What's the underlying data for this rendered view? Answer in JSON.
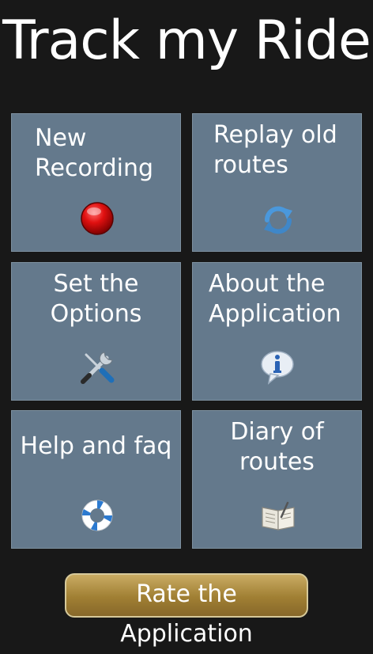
{
  "app": {
    "title": "Track my Ride"
  },
  "tiles": [
    {
      "label": "New\nRecording",
      "icon": "record-icon"
    },
    {
      "label": "Replay old\nroutes",
      "icon": "refresh-icon"
    },
    {
      "label": "Set the\nOptions",
      "icon": "tools-icon"
    },
    {
      "label": "About the\nApplication",
      "icon": "info-icon"
    },
    {
      "label": "Help and faq",
      "icon": "lifebuoy-icon"
    },
    {
      "label": "Diary of\nroutes",
      "icon": "book-icon"
    }
  ],
  "footer": {
    "rate_label": "Rate the Application"
  },
  "colors": {
    "background": "#181818",
    "tile": "#64798c",
    "button_gold": "#a07f33"
  }
}
